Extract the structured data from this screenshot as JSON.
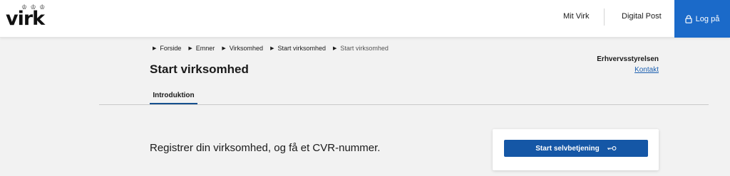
{
  "header": {
    "logo": {
      "crown": "♔ ♔ ♔",
      "text": "virk"
    },
    "nav": [
      {
        "label": "Mit Virk"
      },
      {
        "label": "Digital Post"
      }
    ],
    "login_label": "Log på"
  },
  "breadcrumb": [
    {
      "label": "Forside"
    },
    {
      "label": "Emner"
    },
    {
      "label": "Virksomhed"
    },
    {
      "label": "Start virksomhed"
    },
    {
      "label": "Start virksomhed"
    }
  ],
  "page": {
    "title": "Start virksomhed",
    "org_name": "Erhvervsstyrelsen",
    "org_contact": "Kontakt",
    "tabs": [
      {
        "label": "Introduktion"
      }
    ],
    "intro": "Registrer din virksomhed, og få et CVR-nummer.",
    "cta_label": "Start selvbetjening"
  },
  "colors": {
    "primary_blue": "#1b6ac9",
    "button_blue": "#1557a6",
    "tab_underline": "#15508f",
    "background": "#f2f2f2"
  }
}
